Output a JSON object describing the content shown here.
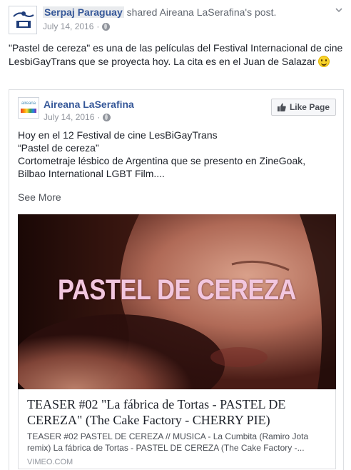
{
  "post": {
    "author": "Serpaj Paraguay",
    "action_text": "shared",
    "original_poster": "Aireana LaSerafina's",
    "post_word": "post.",
    "date": "July 14, 2016",
    "separator": "·",
    "text": "\"Pastel de cereza\" es una de las películas del Festival Internacional de cine LesbiGayTrans que se proyecta hoy. La cita es en el Juan de Salazar",
    "menu_icon": "chevron-down-icon"
  },
  "shared": {
    "page_name": "Aireana LaSerafina",
    "avatar_text": "aireana",
    "date": "July 14, 2016",
    "separator": "·",
    "like_button_label": "Like Page",
    "body_lines": [
      "Hoy en el 12 Festival de cine LesBiGayTrans",
      "“Pastel de cereza”",
      "Cortometraje lésbico de Argentina que se presento en ZineGoak,",
      "Bilbao International LGBT Film...."
    ],
    "see_more": "See More",
    "media_title": "PASTEL DE CEREZA",
    "link": {
      "title": "TEASER #02 \"La fábrica de Tortas - PASTEL DE CEREZA\" (The Cake Factory - CHERRY PIE)",
      "description": "TEASER #02 PASTEL DE CEREZA // MUSICA - La Cumbita (Ramiro Jota remix) La fábrica de Tortas - PASTEL DE CEREZA (The Cake Factory -...",
      "domain": "VIMEO.COM"
    }
  },
  "colors": {
    "link_blue": "#365899",
    "meta_gray": "#90949c",
    "title_pink": "#f2c7df"
  }
}
